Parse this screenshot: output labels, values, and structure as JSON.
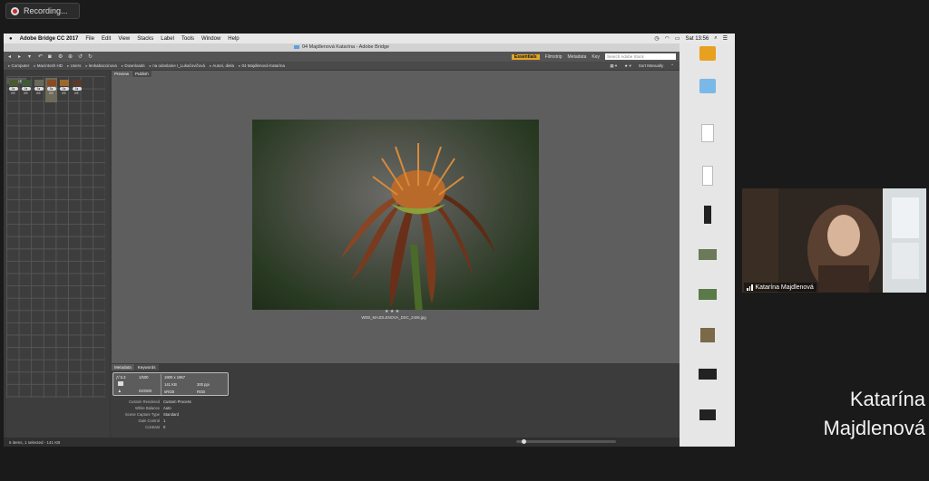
{
  "recording": {
    "label": "Recording..."
  },
  "menubar": {
    "apple": "",
    "app_name": "Adobe Bridge CC 2017",
    "items": [
      "File",
      "Edit",
      "View",
      "Stacks",
      "Label",
      "Tools",
      "Window",
      "Help"
    ],
    "clock": "Sat 13:56"
  },
  "window": {
    "title": "04 Majdlenová Katarína - Adobe Bridge"
  },
  "toolbar": {
    "workspaces": [
      "Essentials",
      "Filmstrip",
      "Metadata",
      "Key"
    ],
    "search_placeholder": "Search Adobe Stock"
  },
  "path": {
    "crumbs": [
      "Computer",
      "Macintosh HD",
      "Users",
      "lenkabaccinova",
      "Downloads",
      "na odoslanie I_Lukačovičová",
      "Autori, diela",
      "04 Majdlenová Katarína"
    ],
    "sort_label": "Sort Manually"
  },
  "left_panel": {
    "tab": "Content",
    "thumbs": [
      {
        "badge": "2●",
        "label": "WE"
      },
      {
        "badge": "2●",
        "label": "WE"
      },
      {
        "badge": "3●",
        "label": "WE"
      },
      {
        "badge": "3●",
        "label": "WE"
      },
      {
        "badge": "2●",
        "label": "WE"
      },
      {
        "badge": "2●",
        "label": "WE"
      }
    ]
  },
  "preview": {
    "tabs": [
      "Preview",
      "Publish"
    ],
    "stars": "★ ★ ★",
    "filename": "WEB_MAJDLENOVA_DSC_2406.jpg"
  },
  "metadata": {
    "tabs": [
      "Metadata",
      "Keywords"
    ],
    "box": {
      "fstop": "ƒ/ 5.3",
      "shutter": "1/500",
      "iso": "ISO500",
      "dims": "1800 x 1967",
      "size": "141 KB",
      "ppi": "300 ppi",
      "colorspace": "sRGB",
      "mode": "RGB"
    },
    "rows": [
      {
        "k": "Custom Rendered",
        "v": "Custom Process"
      },
      {
        "k": "White Balance",
        "v": "Auto"
      },
      {
        "k": "Scene Capture Type",
        "v": "Standard"
      },
      {
        "k": "Gain Control",
        "v": "1"
      },
      {
        "k": "Contrast",
        "v": "0"
      }
    ]
  },
  "status": {
    "text": "6 items, 1 selected - 141 KB"
  },
  "desktop": {
    "icons": [
      {
        "name": ""
      },
      {
        "name": ""
      },
      {
        "name": ""
      },
      {
        "name": ""
      },
      {
        "name": ""
      },
      {
        "name": ""
      },
      {
        "name": ""
      },
      {
        "name": ""
      },
      {
        "name": ""
      },
      {
        "name": ""
      },
      {
        "name": ""
      }
    ]
  },
  "camera": {
    "name": "Katarína Majdlenová"
  },
  "overlay_name": {
    "line1": "Katarína",
    "line2": "Majdlenová"
  }
}
